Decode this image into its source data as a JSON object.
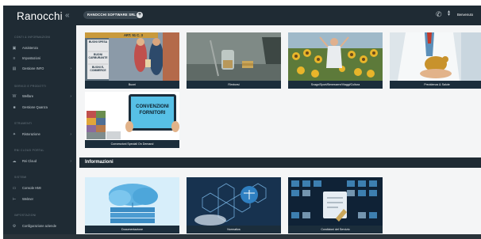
{
  "app": {
    "logo": "Ranocchi",
    "collapse_icon": "chevron-left-icon"
  },
  "sidebar": {
    "sections": [
      {
        "label": "CONTI & INFORMAZIONI",
        "items": [
          {
            "label": "Assistenza",
            "icon": "lock-icon"
          },
          {
            "label": "Impostazioni",
            "icon": "sliders-icon"
          },
          {
            "label": "Gestione INFO",
            "icon": "info-box-icon",
            "has_chevron": true
          }
        ]
      },
      {
        "label": "SERVIZI E PRODOTTI",
        "items": [
          {
            "label": "Welfare",
            "icon": "welfare-icon",
            "has_chevron": true
          },
          {
            "label": "Gestione Quanza",
            "icon": "briefcase-icon"
          }
        ]
      },
      {
        "label": "STRUMENTI",
        "items": [
          {
            "label": "Ristorazione",
            "icon": "wand-icon",
            "has_chevron": true
          }
        ]
      },
      {
        "label": "RNI CLOUD PORTAL",
        "items": [
          {
            "label": "Rni Cloud",
            "icon": "cloud-icon",
            "has_chevron": true
          }
        ]
      },
      {
        "label": "SISTEMI",
        "items": [
          {
            "label": "Console HMI",
            "icon": "monitor-icon"
          },
          {
            "label": "Welmer",
            "icon": "bracket-icon"
          }
        ]
      },
      {
        "label": "IMPOSTAZIONI",
        "items": [
          {
            "label": "Configurazione aziende",
            "icon": "gear-icon"
          }
        ]
      }
    ]
  },
  "topbar": {
    "company": "RANOCCHI SOFTWARE SRL",
    "user": "Benvenuto"
  },
  "cards_top": [
    {
      "caption": "Buoni",
      "img": "buoni"
    },
    {
      "caption": "Rimborsi",
      "img": "rimborsi"
    },
    {
      "caption": "Svago/Sport/Benessere/Viaggi/Cultura",
      "img": "svago"
    },
    {
      "caption": "Previdenza & Salute",
      "img": "previdenza"
    },
    {
      "caption": "Convenzioni Speciali On Demand",
      "img": "convenzioni"
    }
  ],
  "buoni_image": {
    "header": "ART. 51 C. 3",
    "rows": [
      "BUONI SPESA",
      "BUONI CARBURANTE",
      "BUONI E-COMMERCE"
    ]
  },
  "convenzioni_image": {
    "line1": "CONVENZIONI",
    "line2": "FORNITORI"
  },
  "section": {
    "title": "Informazioni"
  },
  "cards_bottom": [
    {
      "caption": "Documentazione",
      "img": "documentazione"
    },
    {
      "caption": "Normativa",
      "img": "normativa"
    },
    {
      "caption": "Condizioni del Servizio",
      "img": "condizioni"
    }
  ],
  "colors": {
    "sidebar": "#1f2b34",
    "caption": "#1b2d3b",
    "accent": "#2f80c2"
  }
}
